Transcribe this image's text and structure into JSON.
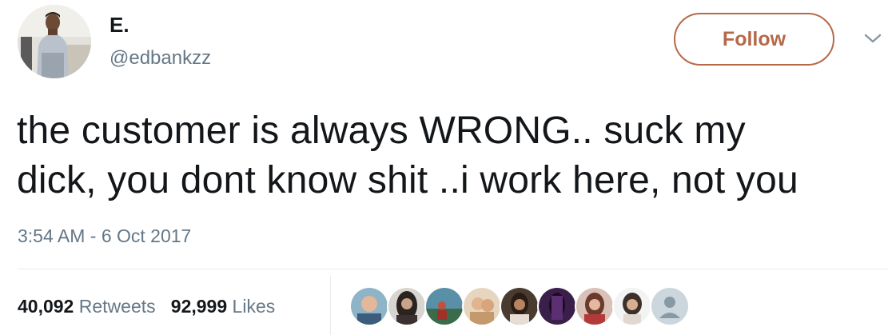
{
  "tweet": {
    "author": {
      "name": "E.",
      "handle": "@edbankzz"
    },
    "follow_label": "Follow",
    "text_lines": [
      "the customer is always WRONG.. suck my",
      "dick, you dont know shit ..i work here, not you"
    ],
    "timestamp": "3:54 AM - 6 Oct 2017",
    "stats": {
      "retweets_count": "40,092",
      "retweets_label": "Retweets",
      "likes_count": "92,999",
      "likes_label": "Likes"
    },
    "liker_avatars_count": 9
  },
  "colors": {
    "follow_accent": "#b5694a",
    "secondary_text": "#657786",
    "primary_text": "#14171a",
    "divider": "#e6ecf0"
  },
  "icons": {
    "menu": "chevron-down-icon"
  }
}
